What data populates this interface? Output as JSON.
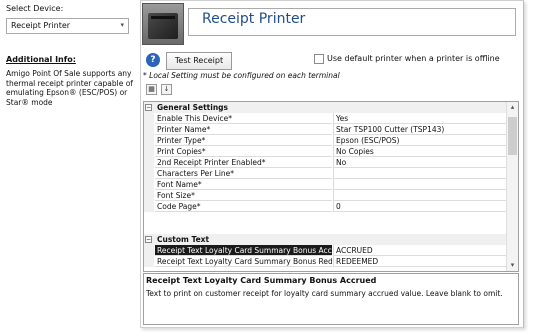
{
  "device": {
    "label": "Select Device:",
    "selected": "Receipt Printer"
  },
  "info": {
    "title": "Additional Info:",
    "text": "Amigo Point Of Sale supports any thermal receipt printer capable of emulating Epson® (ESC/POS) or Star® mode"
  },
  "header": {
    "title": "Receipt Printer"
  },
  "toolbar": {
    "test_label": "Test Receipt",
    "default_printer_label": "Use default printer when a printer is offline",
    "note": "* Local Setting must be configured on each terminal"
  },
  "grid": {
    "sections": [
      {
        "title": "General Settings",
        "rows": [
          {
            "name": "Enable This Device*",
            "value": "Yes"
          },
          {
            "name": "Printer Name*",
            "value": "Star TSP100 Cutter (TSP143)"
          },
          {
            "name": "Printer Type*",
            "value": "Epson (ESC/POS)"
          },
          {
            "name": "Print Copies*",
            "value": "No Copies"
          },
          {
            "name": "2nd Receipt Printer Enabled*",
            "value": "No"
          },
          {
            "name": "Characters Per Line*",
            "value": ""
          },
          {
            "name": "Font Name*",
            "value": ""
          },
          {
            "name": "Font Size*",
            "value": ""
          },
          {
            "name": "Code Page*",
            "value": "0"
          }
        ]
      },
      {
        "title": "Custom Text",
        "rows": [
          {
            "name": "Receipt Text Loyalty Card Summary Bonus Accrued",
            "value": "ACCRUED"
          },
          {
            "name": "Receipt Text Loyalty Card Summary Bonus Redeemed",
            "value": "REDEEMED"
          }
        ]
      }
    ]
  },
  "description": {
    "title": "Receipt Text Loyalty Card Summary Bonus Accrued",
    "text": "Text to print on customer receipt for loyalty card summary accrued value. Leave blank to omit."
  }
}
